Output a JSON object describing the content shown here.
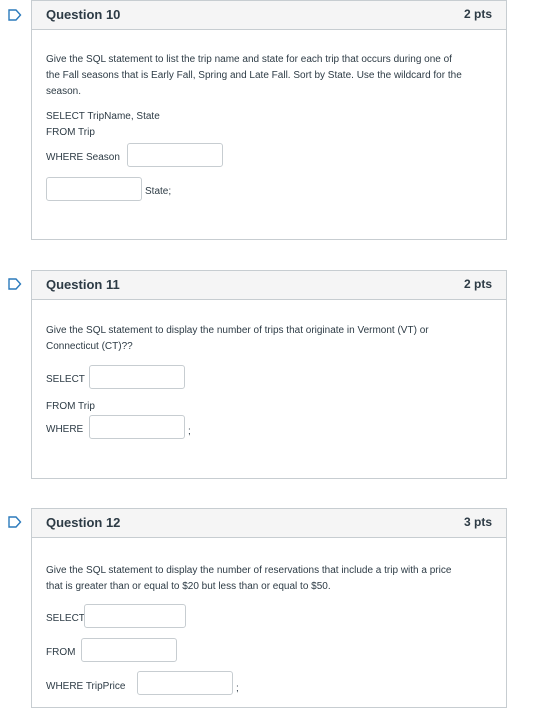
{
  "q10": {
    "title": "Question 10",
    "points": "2 pts",
    "prompt_line1": "Give the SQL statement to list the trip name and state for each trip that occurs during one of",
    "prompt_line2": "the Fall seasons that is Early Fall, Spring and Late Fall. Sort by State. Use the wildcard for the",
    "prompt_line3": "season.",
    "line_select": "SELECT TripName, State",
    "line_from": "FROM Trip",
    "line_where": "WHERE Season",
    "state_suffix": "State;",
    "input1_value": "",
    "input2_value": ""
  },
  "q11": {
    "title": "Question 11",
    "points": "2 pts",
    "prompt_line1": "Give the SQL statement to display the number of trips that originate in Vermont (VT) or",
    "prompt_line2": "Connecticut (CT)??",
    "label_select": "SELECT",
    "line_from": "FROM Trip",
    "label_where": "WHERE",
    "semicolon": ";",
    "input_select_value": "",
    "input_where_value": ""
  },
  "q12": {
    "title": "Question 12",
    "points": "3 pts",
    "prompt_line1": "Give the SQL statement to display the number of reservations that include a trip with a price",
    "prompt_line2": "that is greater than or equal to $20 but less than or equal to $50.",
    "label_select": "SELECT",
    "label_from": "FROM",
    "label_where": "WHERE TripPrice",
    "semicolon": ";",
    "input_select_value": "",
    "input_from_value": "",
    "input_where_value": ""
  },
  "colors": {
    "flag": "#2b7abc",
    "border": "#c7cdd1",
    "header_bg": "#f5f5f5",
    "text": "#2d3b45"
  },
  "icons": {
    "flag": "bookmark-flag-icon"
  }
}
